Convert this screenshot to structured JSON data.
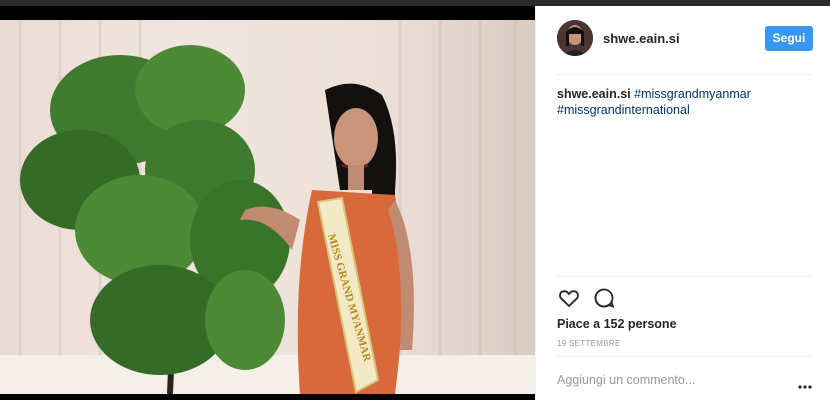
{
  "post": {
    "username": "shwe.eain.si",
    "follow_label": "Segui",
    "caption": {
      "user": "shwe.eain.si",
      "hashtags": [
        "#missgrandmyanmar",
        "#missgrandinternational"
      ]
    },
    "sash_text": "MISS GRAND MYANMAR",
    "likes_text": "Piace a 152 persone",
    "date": "19 SETTEMBRE",
    "comment_placeholder": "Aggiungi un commento..."
  },
  "icons": {
    "like": "heart-icon",
    "comment": "comment-bubble-icon",
    "more": "more-options-icon"
  },
  "colors": {
    "accent": "#3897f0",
    "hashtag": "#003569",
    "muted": "#999999"
  }
}
